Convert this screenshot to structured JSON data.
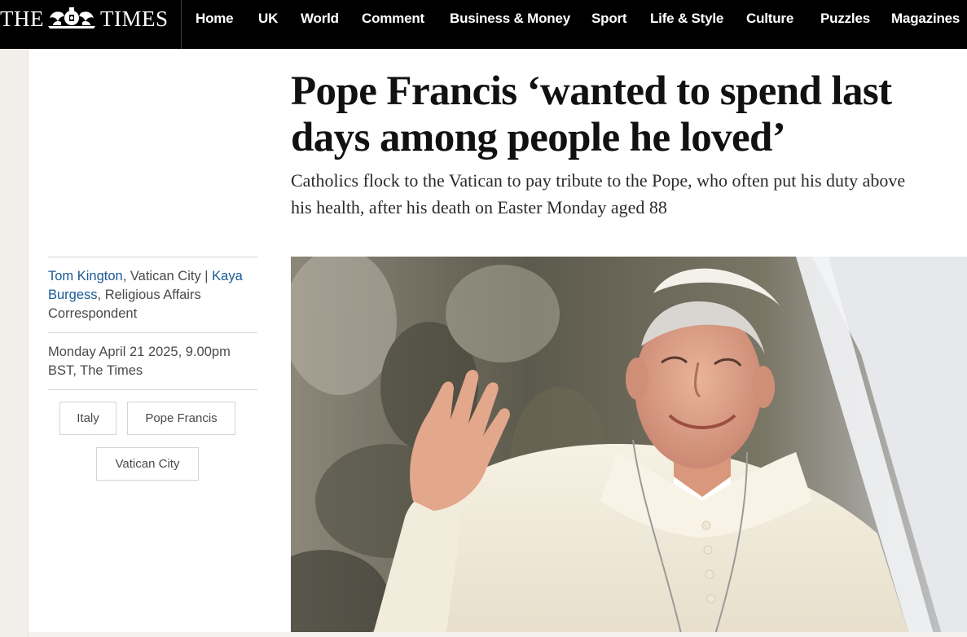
{
  "masthead": {
    "logo_the": "THE",
    "logo_times": "TIMES"
  },
  "nav": {
    "items": [
      "Home",
      "UK",
      "World",
      "Comment",
      "Business & Money",
      "Sport",
      "Life & Style",
      "Culture",
      "Puzzles",
      "Magazines"
    ]
  },
  "article": {
    "headline_line1": "Pope Francis ‘wanted to spend last",
    "headline_line2": "days among people he loved’",
    "standfirst_line1": "Catholics flock to the Vatican to pay tribute to the Pope, who often put his duty above",
    "standfirst_line2": "his health, after his death on Easter Monday aged 88",
    "byline": {
      "author1": "Tom Kington",
      "author1_location": ", Vatican City | ",
      "author2_part1": "Kaya",
      "author2_part2": "Burgess",
      "author2_role": ", Religious Affairs",
      "author2_role2": "Correspondent"
    },
    "dateline_line1": "Monday April 21 2025, 9.00pm",
    "dateline_line2": "BST, The Times",
    "tags": [
      "Italy",
      "Pope Francis",
      "Vatican City"
    ],
    "image_icon": "crest-icon"
  },
  "colors": {
    "nav_bg": "#000000",
    "link": "#1a5a96",
    "gutter": "#f2efeb"
  }
}
